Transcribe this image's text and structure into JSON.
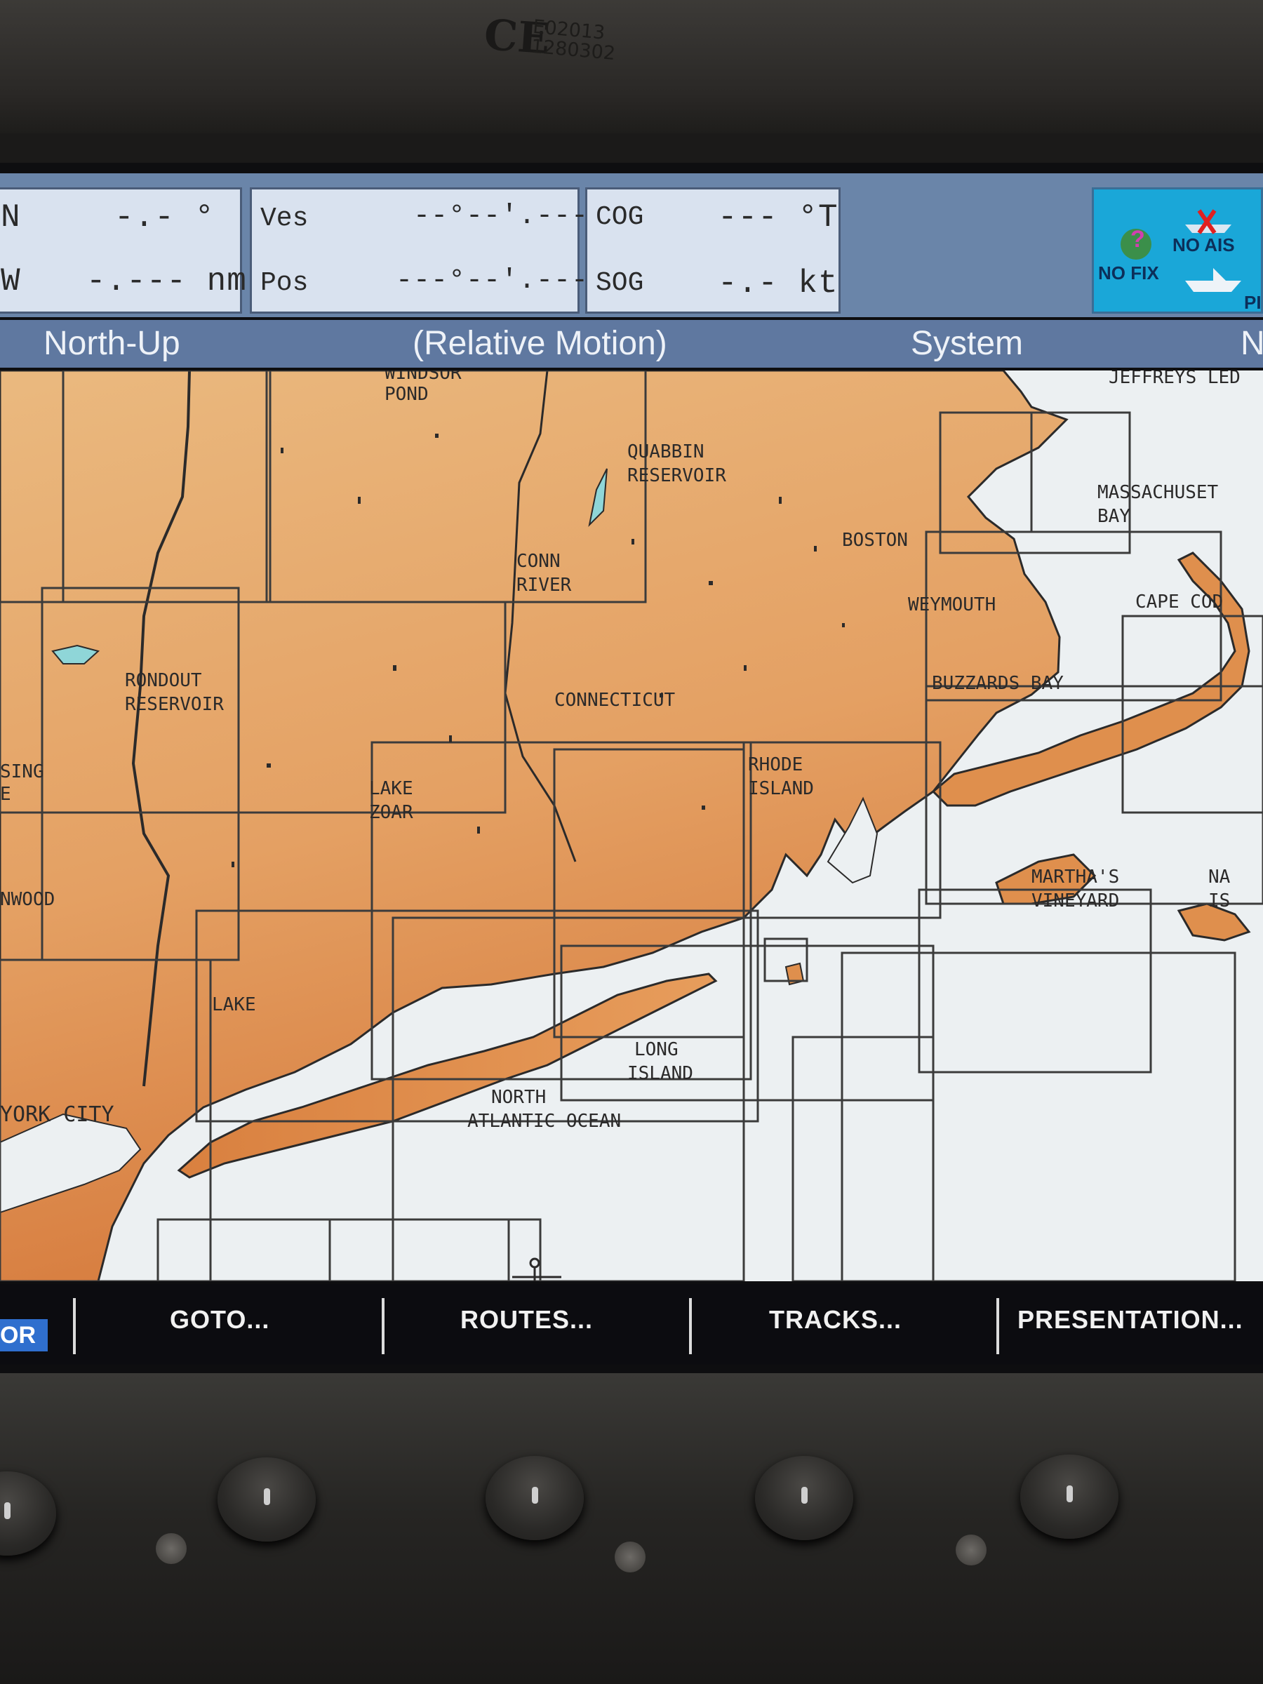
{
  "device": {
    "ce_mark": "CE",
    "cert_code_1": "E02013",
    "cert_code_2": "1280302"
  },
  "databar": {
    "latlon_cell": {
      "row1_label": "N",
      "row1_value": "-.- °",
      "row2_label": "W",
      "row2_value": "-.--- nm"
    },
    "vessel_cell": {
      "row1_label": "Ves",
      "row1_value": "--°--'.---",
      "row2_label": "Pos",
      "row2_value": "---°--'.---"
    },
    "course_cell": {
      "row1_label": "COG",
      "row1_value": "--- °T",
      "row2_label": "SOG",
      "row2_value": "-.- kt"
    },
    "status": {
      "fix_text": "NO FIX",
      "ais_text": "NO AIS",
      "extra_text": "PI"
    }
  },
  "modebar": {
    "orientation": "North-Up",
    "motion": "(Relative Motion)",
    "datum": "System",
    "truncated": "N"
  },
  "chart_labels": {
    "windsor_pond_1": "WINDSOR",
    "windsor_pond_2": "POND",
    "jeffreys_ledge": "JEFFREYS LED",
    "quabbin_1": "QUABBIN",
    "quabbin_2": "RESERVOIR",
    "mass_bay_1": "MASSACHUSET",
    "mass_bay_2": "BAY",
    "boston": "BOSTON",
    "conn_river_1": "CONN",
    "conn_river_2": "RIVER",
    "weymouth": "WEYMOUTH",
    "cape_cod": "CAPE COD",
    "rondout_1": "RONDOUT",
    "rondout_2": "RESERVOIR",
    "connecticut": "CONNECTICUT",
    "buzzards_bay": "BUZZARDS BAY",
    "sing_1": "SING",
    "sing_2": "E",
    "lake_zoar_1": "LAKE",
    "lake_zoar_2": "ZOAR",
    "rhode_island_1": "RHODE",
    "rhode_island_2": "ISLAND",
    "marthas_vineyard_1": "MARTHA'S",
    "marthas_vineyard_2": "VINEYARD",
    "nantucket_1": "NA",
    "nantucket_2": "IS",
    "nwood": "NWOOD",
    "lake": "LAKE",
    "long_island_1": "LONG",
    "long_island_2": "ISLAND",
    "new_york_city": "YORK CITY",
    "ocean_1": "NORTH",
    "ocean_2": "ATLANTIC OCEAN"
  },
  "colors": {
    "land_light": "#e9b47a",
    "land_dark": "#d97a3e",
    "water": "#ecf0f2",
    "chart_border": "#3a3a3a",
    "databar_bg": "#6a85a9",
    "softkey_highlight": "#2f6fce"
  },
  "softkeys": {
    "partial": "OR",
    "goto": "GOTO...",
    "routes": "ROUTES...",
    "tracks": "TRACKS...",
    "presentation": "PRESENTATION..."
  }
}
